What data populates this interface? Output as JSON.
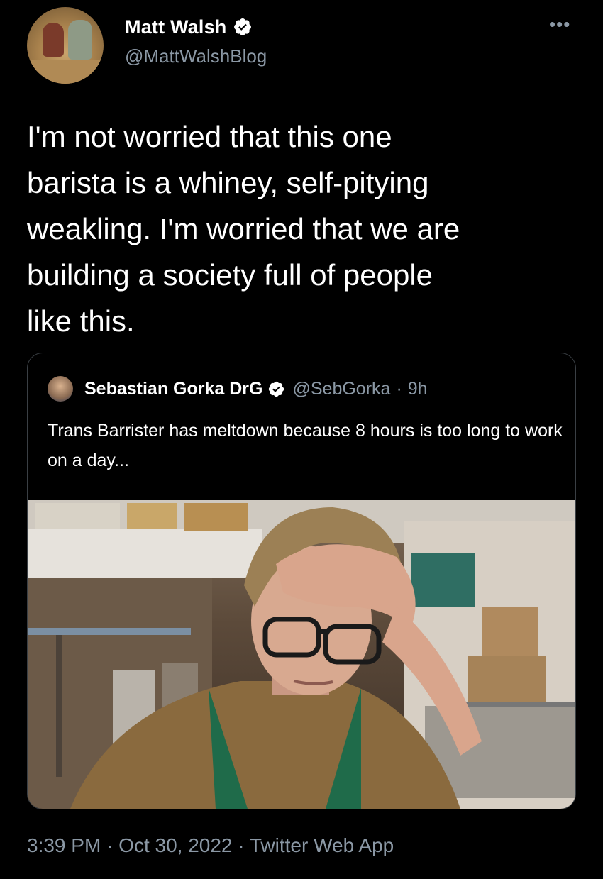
{
  "author": {
    "display_name": "Matt Walsh",
    "handle": "@MattWalshBlog",
    "verified_icon": "verified-badge-icon"
  },
  "more_icon": "more-options-icon",
  "tweet": {
    "text": "I'm not worried that this one\nbarista is a whiney, self-pitying\nweakling. I'm worried that we are\nbuilding a society full of people\nlike this."
  },
  "quoted_tweet": {
    "display_name": "Sebastian Gorka DrG",
    "handle": "@SebGorka",
    "separator": "·",
    "time": "9h",
    "text": "Trans Barrister has meltdown because 8 hours is too long to work on a day...",
    "media_icon": "video-thumbnail"
  },
  "metadata": {
    "text": "3:39 PM · Oct 30, 2022 · Twitter Web App"
  },
  "colors": {
    "background": "#000000",
    "text_primary": "#ffffff",
    "text_secondary": "#8b98a5",
    "verified_blue": "#ffffff",
    "border": "#3a3f44"
  }
}
